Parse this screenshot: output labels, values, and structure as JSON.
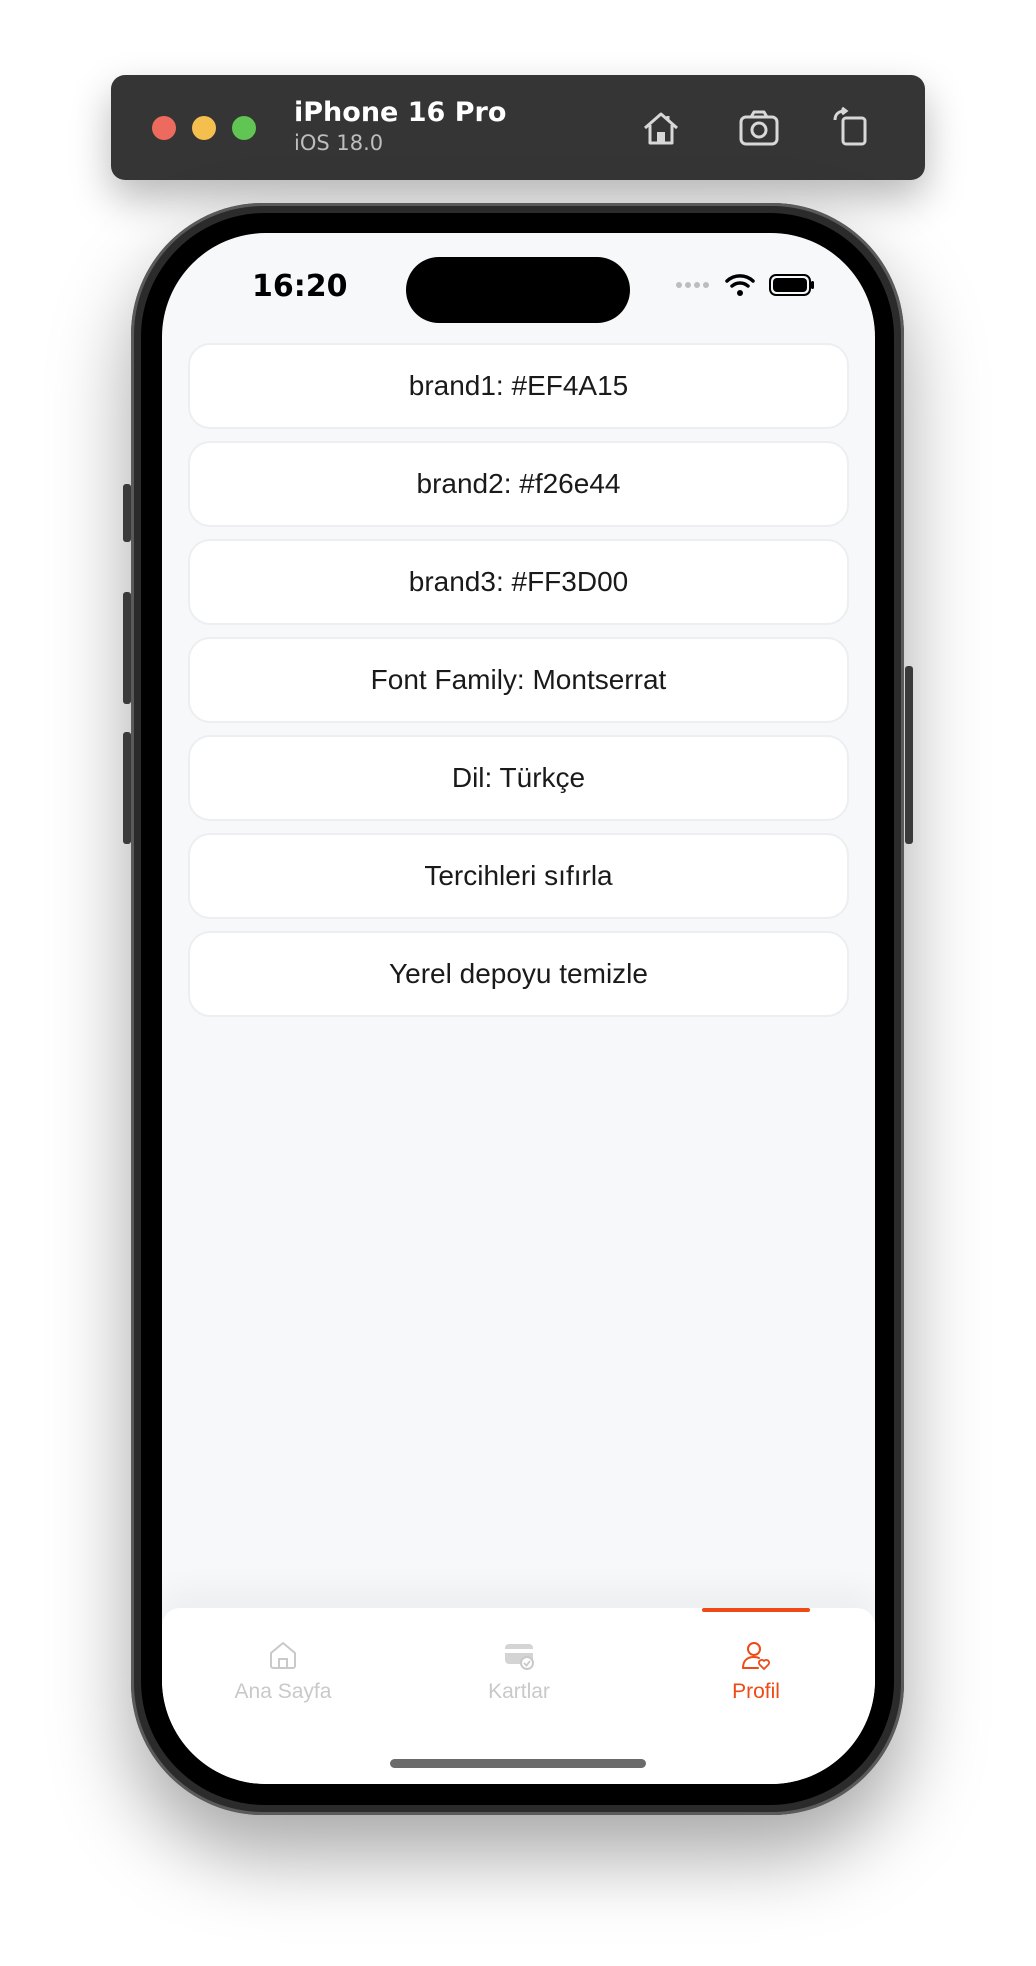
{
  "simulator": {
    "device_name": "iPhone 16 Pro",
    "os_version": "iOS 18.0",
    "buttons": [
      "home-icon",
      "screenshot-icon",
      "rotate-icon"
    ]
  },
  "status_bar": {
    "time": "16:20",
    "icons": [
      "signal-icon",
      "wifi-icon",
      "battery-icon"
    ]
  },
  "settings": {
    "items": [
      {
        "label": "brand1: #EF4A15"
      },
      {
        "label": "brand2: #f26e44"
      },
      {
        "label": "brand3: #FF3D00"
      },
      {
        "label": "Font Family: Montserrat"
      },
      {
        "label": "Dil: Türkçe"
      },
      {
        "label": "Tercihleri sıfırla"
      },
      {
        "label": "Yerel depoyu temizle"
      }
    ]
  },
  "tabbar": {
    "tabs": [
      {
        "label": "Ana Sayfa",
        "icon": "home-icon",
        "active": false
      },
      {
        "label": "Kartlar",
        "icon": "cards-icon",
        "active": false
      },
      {
        "label": "Profil",
        "icon": "profile-icon",
        "active": true
      }
    ]
  },
  "colors": {
    "accent": "#EF4A15",
    "inactive": "#c9c9c9",
    "background": "#f7f8fa"
  }
}
